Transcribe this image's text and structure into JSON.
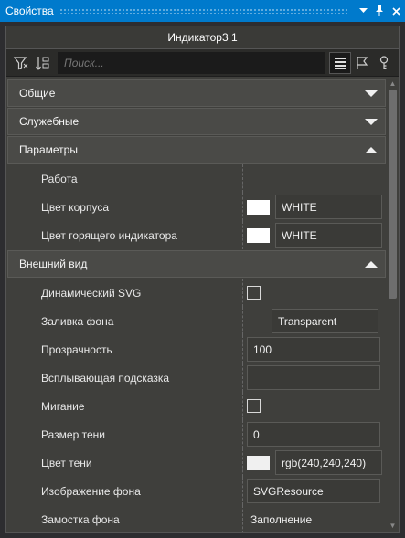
{
  "window": {
    "title": "Свойства",
    "pin_glyph": "▾",
    "dock_glyph": "⊥",
    "close_glyph": "✕"
  },
  "object_title": "Индикатор3 1",
  "toolbar": {
    "search_placeholder": "Поиск..."
  },
  "sections": {
    "general": {
      "label": "Общие",
      "expanded": false
    },
    "service": {
      "label": "Служебные",
      "expanded": false
    },
    "params": {
      "label": "Параметры",
      "expanded": true
    },
    "appearance": {
      "label": "Внешний вид",
      "expanded": true
    }
  },
  "params_rows": {
    "work": {
      "label": "Работа",
      "value": ""
    },
    "body_color": {
      "label": "Цвет корпуса",
      "value": "WHITE",
      "swatch": "#ffffff"
    },
    "lit_color": {
      "label": "Цвет горящего индикатора",
      "value": "WHITE",
      "swatch": "#ffffff"
    }
  },
  "appearance_rows": {
    "dyn_svg": {
      "label": "Динамический SVG",
      "checked": false
    },
    "fill": {
      "label": "Заливка фона",
      "value": "Transparent"
    },
    "opacity": {
      "label": "Прозрачность",
      "value": "100"
    },
    "tooltip": {
      "label": "Всплывающая подсказка",
      "value": ""
    },
    "blink": {
      "label": "Мигание",
      "checked": false
    },
    "shadow_size": {
      "label": "Размер тени",
      "value": "0"
    },
    "shadow_color": {
      "label": "Цвет тени",
      "value": "rgb(240,240,240)",
      "swatch": "#f0f0f0"
    },
    "bg_image": {
      "label": "Изображение фона",
      "value": "SVGResource"
    },
    "bg_tiling": {
      "label": "Замостка фона",
      "value": "Заполнение"
    }
  },
  "colors": {
    "accent": "#007acc",
    "panel": "#3f3f3c",
    "section": "#4a4a47"
  }
}
